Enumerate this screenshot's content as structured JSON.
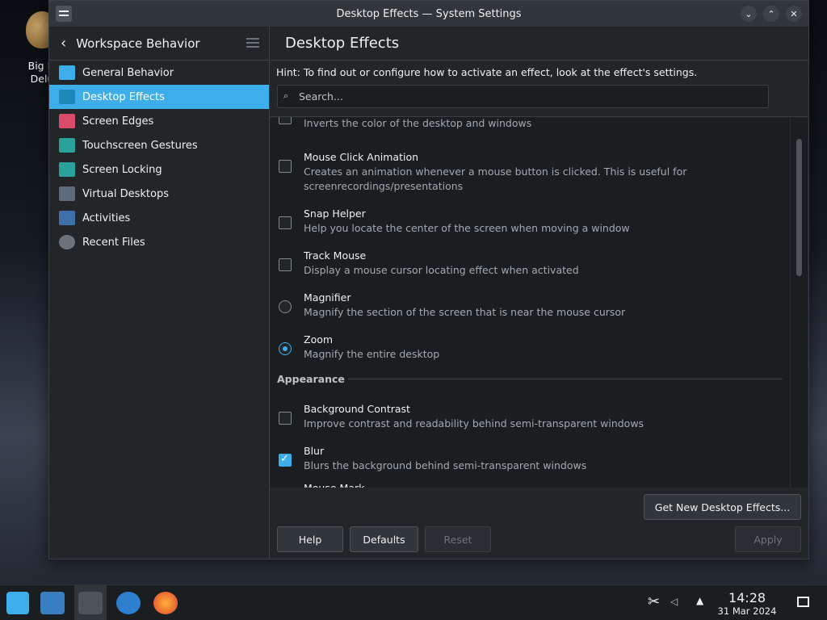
{
  "desktop": {
    "icon_label": "Big M\nDelu"
  },
  "window": {
    "title": "Desktop Effects — System Settings",
    "buttons": [
      "minimize",
      "maximize",
      "close"
    ]
  },
  "sidebar": {
    "header": "Workspace Behavior",
    "items": [
      {
        "label": "General Behavior",
        "active": false,
        "icon": "general-behavior-icon"
      },
      {
        "label": "Desktop Effects",
        "active": true,
        "icon": "desktop-effects-icon"
      },
      {
        "label": "Screen Edges",
        "active": false,
        "icon": "screen-edges-icon"
      },
      {
        "label": "Touchscreen Gestures",
        "active": false,
        "icon": "touchscreen-icon"
      },
      {
        "label": "Screen Locking",
        "active": false,
        "icon": "screen-lock-icon"
      },
      {
        "label": "Virtual Desktops",
        "active": false,
        "icon": "virtual-desktops-icon"
      },
      {
        "label": "Activities",
        "active": false,
        "icon": "activities-icon"
      },
      {
        "label": "Recent Files",
        "active": false,
        "icon": "clock-icon"
      }
    ]
  },
  "main": {
    "title": "Desktop Effects",
    "hint": "Hint: To find out or configure how to activate an effect, look at the effect's settings.",
    "search_placeholder": "Search...",
    "effects_top": [
      {
        "name": "",
        "desc": "Inverts the color of the desktop and windows",
        "control": "checkbox",
        "checked": false
      },
      {
        "name": "Mouse Click Animation",
        "desc": "Creates an animation whenever a mouse button is clicked. This is useful for screenrecordings/presentations",
        "control": "checkbox",
        "checked": false
      },
      {
        "name": "Snap Helper",
        "desc": "Help you locate the center of the screen when moving a window",
        "control": "checkbox",
        "checked": false
      },
      {
        "name": "Track Mouse",
        "desc": "Display a mouse cursor locating effect when activated",
        "control": "checkbox",
        "checked": false
      },
      {
        "name": "Magnifier",
        "desc": "Magnify the section of the screen that is near the mouse cursor",
        "control": "radio",
        "checked": false
      },
      {
        "name": "Zoom",
        "desc": "Magnify the entire desktop",
        "control": "radio",
        "checked": true
      }
    ],
    "section_appearance": "Appearance",
    "effects_appearance": [
      {
        "name": "Background Contrast",
        "desc": "Improve contrast and readability behind semi-transparent windows",
        "control": "checkbox",
        "checked": false
      },
      {
        "name": "Blur",
        "desc": "Blurs the background behind semi-transparent windows",
        "control": "checkbox",
        "checked": true
      },
      {
        "name": "Mouse Mark",
        "desc": "",
        "control": "checkbox",
        "checked": false
      }
    ],
    "get_new_label": "Get New Desktop Effects...",
    "help_label": "Help",
    "defaults_label": "Defaults",
    "reset_label": "Reset",
    "apply_label": "Apply"
  },
  "taskbar": {
    "time": "14:28",
    "date": "31 Mar 2024"
  },
  "colors": {
    "accent": "#3daee9",
    "window_bg": "#232629",
    "list_bg": "#1b1e20"
  }
}
